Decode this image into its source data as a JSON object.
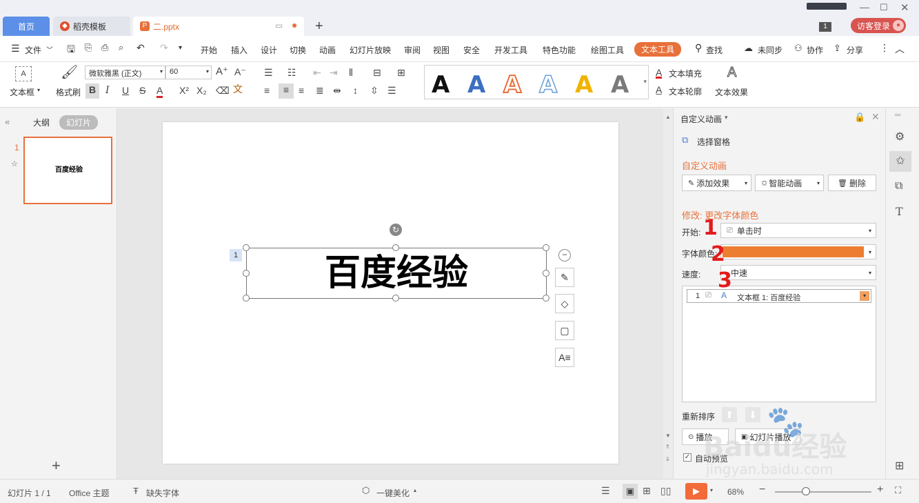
{
  "tabs": {
    "home": "首页",
    "docer": "稻壳模板",
    "doc": "二.pptx",
    "page_badge": "1",
    "login": "访客登录"
  },
  "menu": {
    "file": "文件",
    "items": [
      "开始",
      "插入",
      "设计",
      "切换",
      "动画",
      "幻灯片放映",
      "审阅",
      "视图",
      "安全",
      "开发工具",
      "特色功能",
      "绘图工具"
    ],
    "active": "文本工具",
    "search": "查找",
    "sync": "未同步",
    "collab": "协作",
    "share": "分享"
  },
  "ribbon": {
    "textbox": "文本框",
    "format_painter": "格式刷",
    "font_name": "微软雅黑 (正文)",
    "font_size": "60",
    "text_fill": "文本填充",
    "text_outline": "文本轮廓",
    "text_effect": "文本效果",
    "wordart_colors": [
      "#111111",
      "#3c6fc2",
      "#e8703a",
      "#6a9fd8",
      "#f0b400",
      "#7a7a7a"
    ]
  },
  "left_panel": {
    "outline_tab": "大纲",
    "slides_tab": "幻灯片",
    "slide_number": "1",
    "thumb_title": "百度经验"
  },
  "slide": {
    "title": "百度经验",
    "anim_marker": "1"
  },
  "right_panel": {
    "header": "自定义动画",
    "selection_pane": "选择窗格",
    "section_title": "自定义动画",
    "add_effect": "添加效果",
    "smart_anim": "智能动画",
    "delete": "删除",
    "modify_title": "修改: 更改字体颜色",
    "start_label": "开始:",
    "start_value": "单击时",
    "color_label": "字体颜色:",
    "color_value": "#ed7d31",
    "speed_label": "速度:",
    "speed_value": "中速",
    "list_item_num": "1",
    "list_item_text": "文本框 1: 百度经验",
    "reorder": "重新排序",
    "play": "播放",
    "slideshow": "幻灯片播放",
    "auto_preview": "自动预览"
  },
  "annotations": [
    "1",
    "2",
    "3"
  ],
  "status": {
    "slide_info": "幻灯片 1 / 1",
    "theme": "Office 主题",
    "missing_font": "缺失字体",
    "beautify": "一键美化",
    "zoom": "68%"
  },
  "watermark": {
    "line1": "Baidu经验",
    "line2": "jingyan.baidu.com"
  }
}
